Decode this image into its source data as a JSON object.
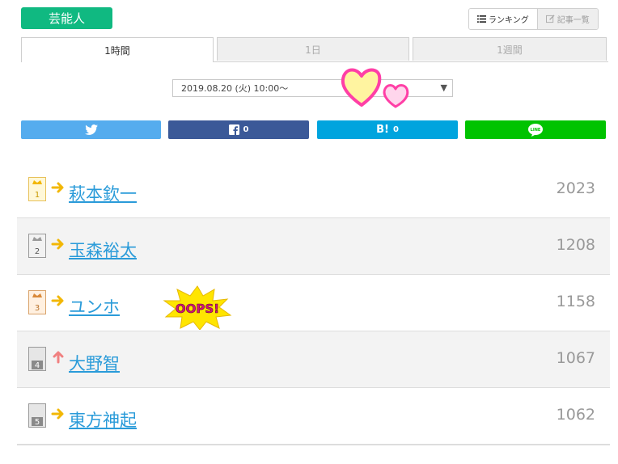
{
  "category": "芸能人",
  "view_switch": {
    "ranking_label": "ランキング",
    "articles_label": "記事一覧"
  },
  "tabs": [
    {
      "label": "1時間",
      "active": true
    },
    {
      "label": "1日",
      "active": false
    },
    {
      "label": "1週間",
      "active": false
    }
  ],
  "date_select": {
    "value": "2019.08.20 (火) 10:00〜"
  },
  "share": {
    "facebook_count": "0",
    "hatena_label": "B!",
    "hatena_count": "0",
    "line_label": "LINE"
  },
  "colors": {
    "category": "#10b981",
    "twitter": "#55acee",
    "facebook": "#3b5998",
    "hatena": "#00a4de",
    "line": "#00c300",
    "link": "#2a9bd9"
  },
  "ranking": [
    {
      "rank": "1",
      "trend": "same",
      "name": "萩本欽一",
      "count": "2023"
    },
    {
      "rank": "2",
      "trend": "same",
      "name": "玉森裕太",
      "count": "1208"
    },
    {
      "rank": "3",
      "trend": "same",
      "name": "ユンホ",
      "count": "1158"
    },
    {
      "rank": "4",
      "trend": "up",
      "name": "大野智",
      "count": "1067"
    },
    {
      "rank": "5",
      "trend": "same",
      "name": "東方神起",
      "count": "1062"
    }
  ],
  "stickers": {
    "oops": "OOPS!"
  }
}
